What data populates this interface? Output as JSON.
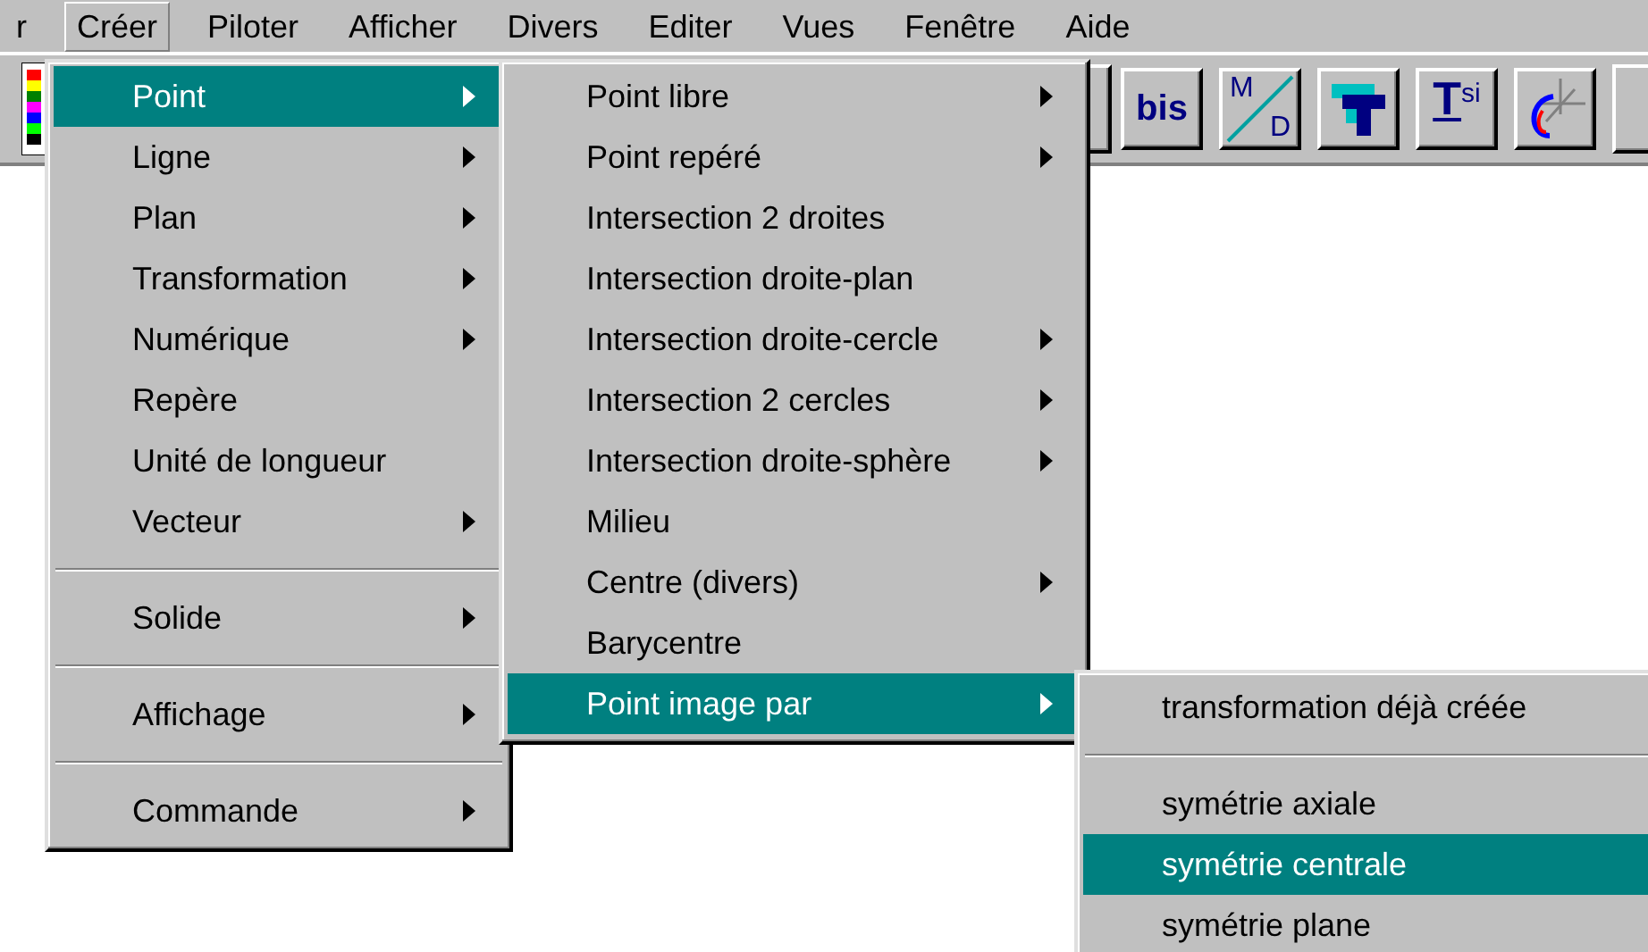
{
  "menu_bar": [
    {
      "label": "r",
      "selected": false
    },
    {
      "label": "Créer",
      "selected": true
    },
    {
      "label": "Piloter",
      "selected": false
    },
    {
      "label": "Afficher",
      "selected": false
    },
    {
      "label": "Divers",
      "selected": false
    },
    {
      "label": "Editer",
      "selected": false
    },
    {
      "label": "Vues",
      "selected": false
    },
    {
      "label": "Fenêtre",
      "selected": false
    },
    {
      "label": "Aide",
      "selected": false
    }
  ],
  "toolbar": {
    "bis_button": "bis",
    "md_button": [
      "M",
      "D"
    ],
    "tsi_button": [
      "T",
      "si"
    ]
  },
  "menus": [
    {
      "items": [
        {
          "kind": "item",
          "label": "Point",
          "submenu": true,
          "selected": true
        },
        {
          "kind": "item",
          "label": "Ligne",
          "submenu": true,
          "selected": false
        },
        {
          "kind": "item",
          "label": "Plan",
          "submenu": true,
          "selected": false
        },
        {
          "kind": "item",
          "label": "Transformation",
          "submenu": true,
          "selected": false
        },
        {
          "kind": "item",
          "label": "Numérique",
          "submenu": true,
          "selected": false
        },
        {
          "kind": "item",
          "label": "Repère",
          "submenu": false,
          "selected": false
        },
        {
          "kind": "item",
          "label": "Unité de longueur",
          "submenu": false,
          "selected": false
        },
        {
          "kind": "item",
          "label": "Vecteur",
          "submenu": true,
          "selected": false
        },
        {
          "kind": "separator"
        },
        {
          "kind": "item",
          "label": "Solide",
          "submenu": true,
          "selected": false
        },
        {
          "kind": "separator"
        },
        {
          "kind": "item",
          "label": "Affichage",
          "submenu": true,
          "selected": false
        },
        {
          "kind": "separator"
        },
        {
          "kind": "item",
          "label": "Commande",
          "submenu": true,
          "selected": false
        }
      ]
    },
    {
      "items": [
        {
          "kind": "item",
          "label": "Point libre",
          "submenu": true,
          "selected": false
        },
        {
          "kind": "item",
          "label": "Point repéré",
          "submenu": true,
          "selected": false
        },
        {
          "kind": "item",
          "label": "Intersection 2 droites",
          "submenu": false,
          "selected": false
        },
        {
          "kind": "item",
          "label": "Intersection droite-plan",
          "submenu": false,
          "selected": false
        },
        {
          "kind": "item",
          "label": "Intersection droite-cercle",
          "submenu": true,
          "selected": false
        },
        {
          "kind": "item",
          "label": "Intersection 2 cercles",
          "submenu": true,
          "selected": false
        },
        {
          "kind": "item",
          "label": "Intersection droite-sphère",
          "submenu": true,
          "selected": false
        },
        {
          "kind": "item",
          "label": "Milieu",
          "submenu": false,
          "selected": false
        },
        {
          "kind": "item",
          "label": "Centre (divers)",
          "submenu": true,
          "selected": false
        },
        {
          "kind": "item",
          "label": "Barycentre",
          "submenu": false,
          "selected": false
        },
        {
          "kind": "item",
          "label": "Point image par",
          "submenu": true,
          "selected": true
        }
      ]
    },
    {
      "items": [
        {
          "kind": "item",
          "label": "transformation déjà créée",
          "submenu": false,
          "selected": false
        },
        {
          "kind": "separator"
        },
        {
          "kind": "item",
          "label": "symétrie axiale",
          "submenu": false,
          "selected": false
        },
        {
          "kind": "item",
          "label": "symétrie centrale",
          "submenu": false,
          "selected": true
        },
        {
          "kind": "item",
          "label": "symétrie plane",
          "submenu": false,
          "selected": false
        }
      ]
    }
  ]
}
